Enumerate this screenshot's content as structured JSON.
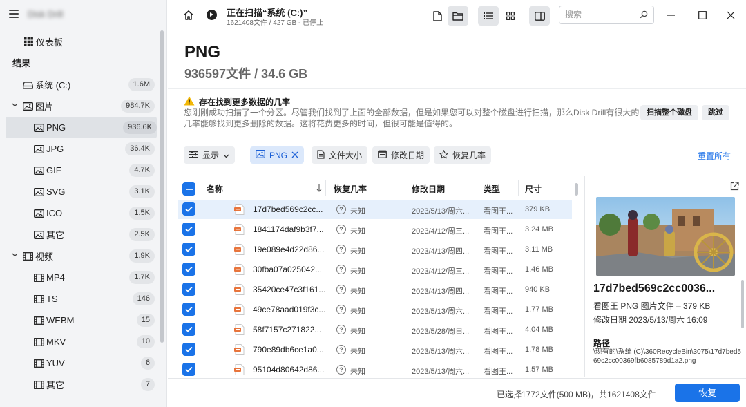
{
  "app": {
    "title": "Disk Drill"
  },
  "sidebar": {
    "dashboard_label": "仪表板",
    "results_label": "结果",
    "items": [
      {
        "label": "系统 (C:)",
        "count": "1.6M",
        "icon": "drive-icon",
        "level": 0
      },
      {
        "label": "图片",
        "count": "984.7K",
        "icon": "picture-icon",
        "level": 0,
        "expanded": true
      },
      {
        "label": "PNG",
        "count": "936.6K",
        "icon": "picture-icon",
        "level": 1,
        "selected": true
      },
      {
        "label": "JPG",
        "count": "36.4K",
        "icon": "picture-icon",
        "level": 1
      },
      {
        "label": "GIF",
        "count": "4.7K",
        "icon": "picture-icon",
        "level": 1
      },
      {
        "label": "SVG",
        "count": "3.1K",
        "icon": "picture-icon",
        "level": 1
      },
      {
        "label": "ICO",
        "count": "1.5K",
        "icon": "picture-icon",
        "level": 1
      },
      {
        "label": "其它",
        "count": "2.5K",
        "icon": "picture-icon",
        "level": 1
      },
      {
        "label": "视频",
        "count": "1.9K",
        "icon": "film-icon",
        "level": 0,
        "expanded": true
      },
      {
        "label": "MP4",
        "count": "1.7K",
        "icon": "film-icon",
        "level": 1
      },
      {
        "label": "TS",
        "count": "146",
        "icon": "film-icon",
        "level": 1
      },
      {
        "label": "WEBM",
        "count": "15",
        "icon": "film-icon",
        "level": 1
      },
      {
        "label": "MKV",
        "count": "10",
        "icon": "film-icon",
        "level": 1
      },
      {
        "label": "YUV",
        "count": "6",
        "icon": "film-icon",
        "level": 1
      },
      {
        "label": "其它",
        "count": "7",
        "icon": "film-icon",
        "level": 1
      }
    ]
  },
  "header": {
    "scan_title": "正在扫描“系统 (C:)”",
    "scan_sub": "1621408文件 / 427 GB - 已停止",
    "search_placeholder": "搜索"
  },
  "page": {
    "title": "PNG",
    "subtitle": "936597文件 / 34.6 GB"
  },
  "banner": {
    "title": "存在找到更多数据的几率",
    "text": "您刚刚成功扫描了一个分区。尽管我们找到了上面的全部数据，但是如果您可以对整个磁盘进行扫描，那么Disk Drill有很大的几率能够找到更多删除的数据。这将花费更多的时间，但很可能是值得的。",
    "scan_disk_button": "扫描整个磁盘",
    "skip_button": "跳过"
  },
  "filters": {
    "show_label": "显示",
    "png_chip": "PNG",
    "size_label": "文件大小",
    "date_label": "修改日期",
    "chance_label": "恢复几率",
    "reset_label": "重置所有"
  },
  "table": {
    "columns": {
      "name": "名称",
      "chance": "恢复几率",
      "date": "修改日期",
      "type": "类型",
      "size": "尺寸"
    },
    "rows": [
      {
        "name": "17d7bed569c2cc...",
        "chance": "未知",
        "date": "2023/5/13/周六...",
        "type": "看图王...",
        "size": "379 KB",
        "selected": true
      },
      {
        "name": "1841174daf9b3f7...",
        "chance": "未知",
        "date": "2023/4/12/周三...",
        "type": "看图王...",
        "size": "3.24 MB"
      },
      {
        "name": "19e089e4d22d86...",
        "chance": "未知",
        "date": "2023/4/13/周四...",
        "type": "看图王...",
        "size": "3.11 MB"
      },
      {
        "name": "30fba07a025042...",
        "chance": "未知",
        "date": "2023/4/12/周三...",
        "type": "看图王...",
        "size": "1.46 MB"
      },
      {
        "name": "35420ce47c3f161...",
        "chance": "未知",
        "date": "2023/4/13/周四...",
        "type": "看图王...",
        "size": "940 KB"
      },
      {
        "name": "49ce78aad019f3c...",
        "chance": "未知",
        "date": "2023/5/13/周六...",
        "type": "看图王...",
        "size": "1.77 MB"
      },
      {
        "name": "58f7157c271822...",
        "chance": "未知",
        "date": "2023/5/28/周日...",
        "type": "看图王...",
        "size": "4.04 MB"
      },
      {
        "name": "790e89db6ce1a0...",
        "chance": "未知",
        "date": "2023/5/13/周六...",
        "type": "看图王...",
        "size": "1.78 MB"
      },
      {
        "name": "95104d80642d86...",
        "chance": "未知",
        "date": "2023/5/13/周六...",
        "type": "看图王...",
        "size": "1.57 MB"
      }
    ]
  },
  "preview": {
    "name": "17d7bed569c2cc0036...",
    "type_line": "看图王 PNG 图片文件 – 379 KB",
    "date_line": "修改日期 2023/5/13/周六 16:09",
    "path_heading": "路径",
    "path": "\\现有的\\系统 (C)\\360RecycleBin\\3075\\17d7bed569c2cc00369fb6085789d1a2.png"
  },
  "footer": {
    "status": "已选择1772文件(500 MB)，共1621408文件",
    "recover_button": "恢复"
  },
  "colors": {
    "accent": "#1a73e8",
    "selected_row": "#e6f0fc",
    "sidebar_bg": "#f3f4f6"
  }
}
